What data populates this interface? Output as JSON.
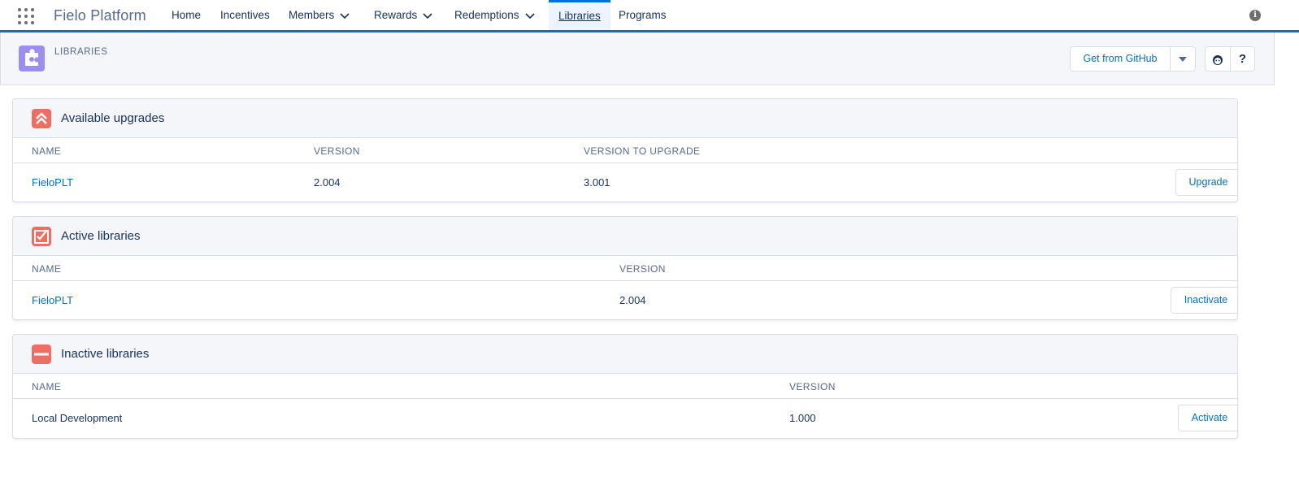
{
  "topnav": {
    "app_name": "Fielo Platform",
    "items": [
      {
        "label": "Home",
        "has_menu": false
      },
      {
        "label": "Incentives",
        "has_menu": false
      },
      {
        "label": "Members",
        "has_menu": true
      },
      {
        "label": "Rewards",
        "has_menu": true
      },
      {
        "label": "Redemptions",
        "has_menu": true
      },
      {
        "label": "Libraries",
        "has_menu": false,
        "active": true
      },
      {
        "label": "Programs",
        "has_menu": false
      }
    ],
    "info_icon": "info-icon"
  },
  "page_header": {
    "title": "LIBRARIES",
    "icon": "puzzle-icon",
    "github_button": "Get from GitHub",
    "help_button": "?"
  },
  "upgrades": {
    "title": "Available upgrades",
    "icon": "double-chevron-up-icon",
    "columns": [
      "NAME",
      "VERSION",
      "VERSION TO UPGRADE"
    ],
    "rows": [
      {
        "name": "FieloPLT",
        "version": "2.004",
        "upgrade_version": "3.001",
        "action": "Upgrade"
      }
    ]
  },
  "active": {
    "title": "Active libraries",
    "icon": "checked-tray-icon",
    "columns": [
      "NAME",
      "VERSION"
    ],
    "rows": [
      {
        "name": "FieloPLT",
        "version": "2.004",
        "action": "Inactivate"
      }
    ]
  },
  "inactive": {
    "title": "Inactive libraries",
    "icon": "minus-icon",
    "columns": [
      "NAME",
      "VERSION"
    ],
    "rows": [
      {
        "name": "Local Development",
        "version": "1.000",
        "action": "Activate"
      }
    ]
  },
  "colors": {
    "brand": "#0070d2",
    "card_icon": "#ef6e64",
    "header_icon": "#9b8ef0",
    "text": "#16325c",
    "muted": "#54698d"
  }
}
